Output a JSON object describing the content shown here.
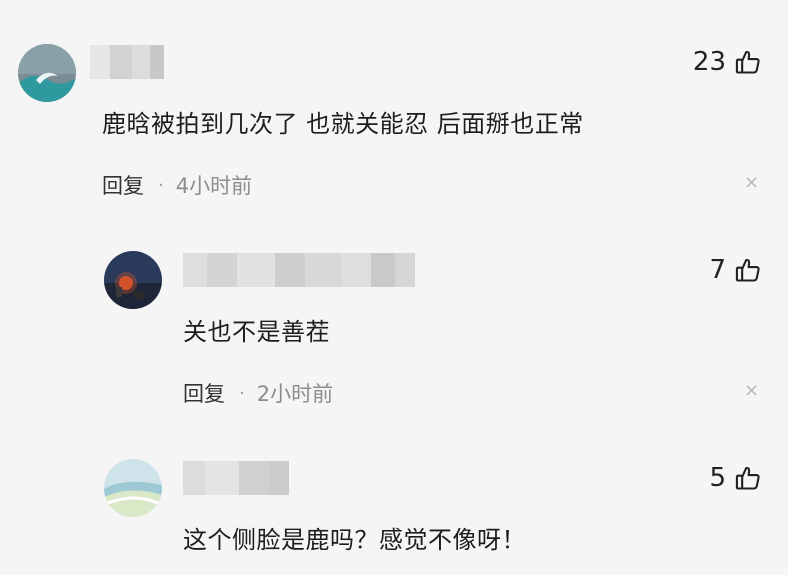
{
  "comments": [
    {
      "likes": "23",
      "text": "鹿晗被拍到几次了 也就关能忍 后面掰也正常",
      "reply_label": "回复",
      "separator": "·",
      "time": "4小时前",
      "close_glyph": "×"
    },
    {
      "likes": "7",
      "text": "关也不是善茬",
      "reply_label": "回复",
      "separator": "·",
      "time": "2小时前",
      "close_glyph": "×"
    },
    {
      "likes": "5",
      "text": "这个侧脸是鹿吗？感觉不像呀！"
    }
  ],
  "icons": {
    "like": "thumbs-up-icon",
    "close": "close-icon"
  },
  "colors": {
    "background": "#f5f5f5",
    "meta_text": "#8d8d8d",
    "close": "#b5b5b5"
  }
}
